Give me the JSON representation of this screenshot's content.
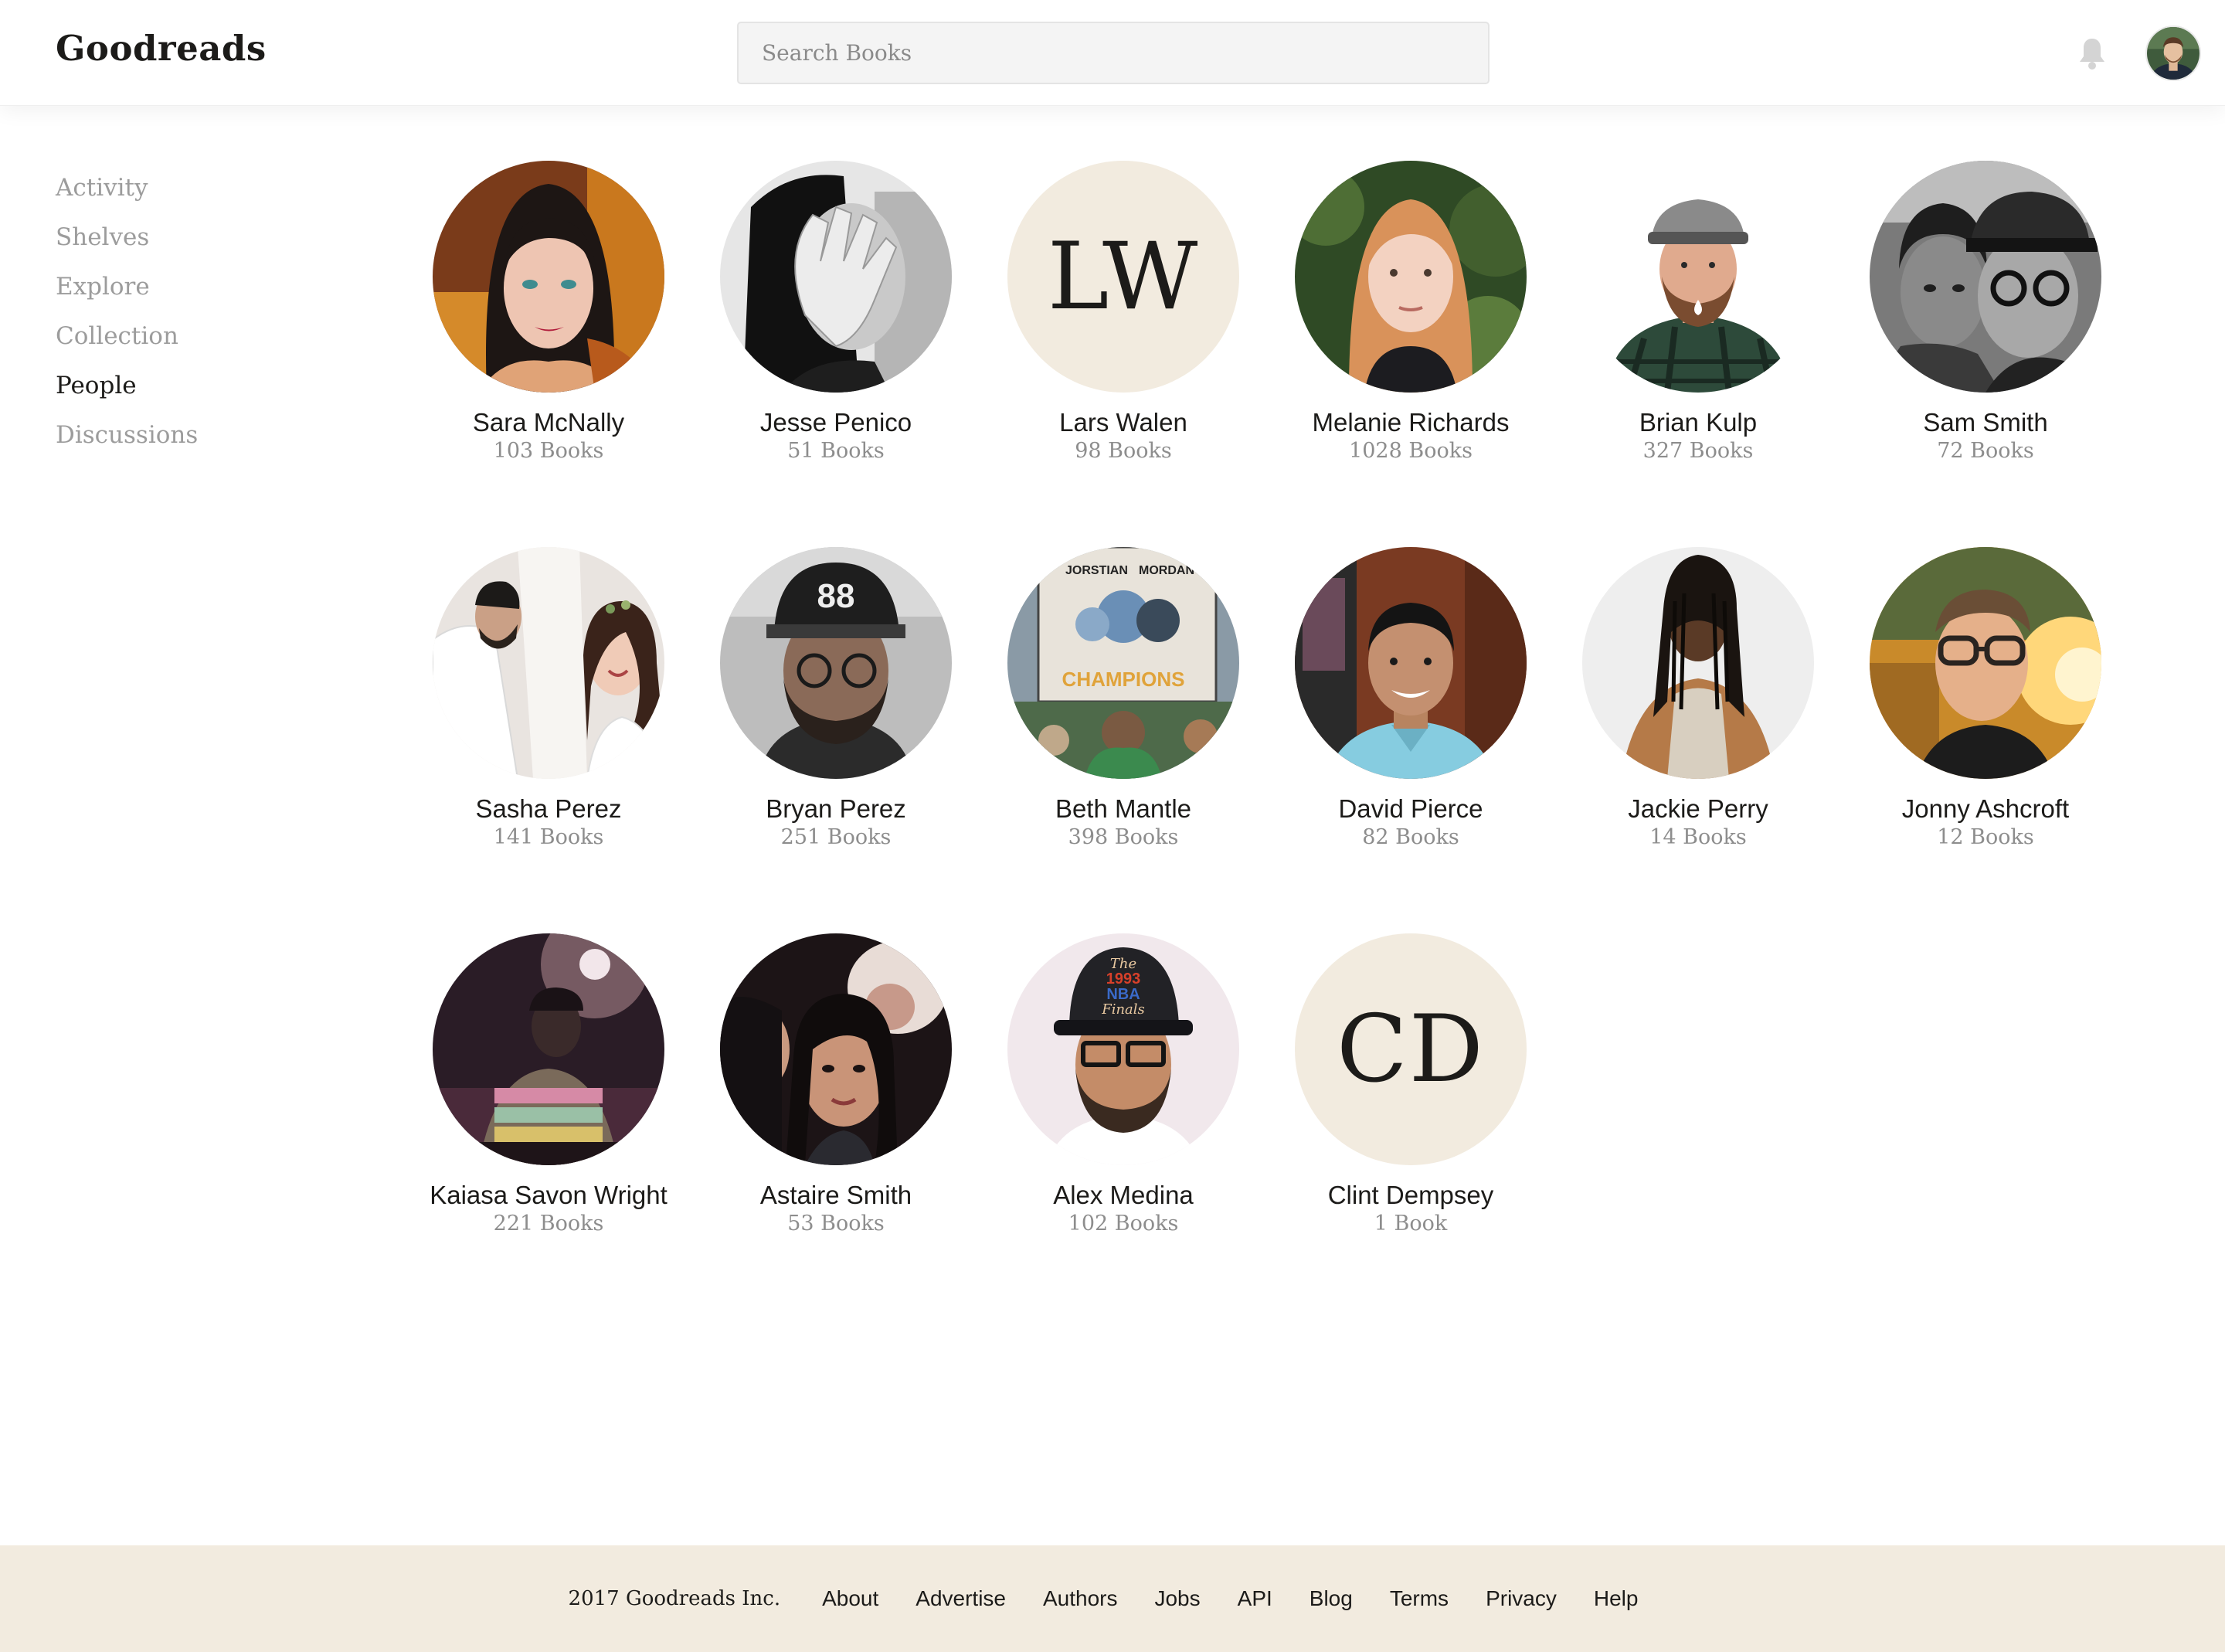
{
  "header": {
    "brand": "Goodreads",
    "search_placeholder": "Search Books"
  },
  "sidebar": {
    "items": [
      {
        "label": "Activity",
        "active": false
      },
      {
        "label": "Shelves",
        "active": false
      },
      {
        "label": "Explore",
        "active": false
      },
      {
        "label": "Collection",
        "active": false
      },
      {
        "label": "People",
        "active": true
      },
      {
        "label": "Discussions",
        "active": false
      }
    ]
  },
  "people": [
    {
      "name": "Sara McNally",
      "books": "103 Books"
    },
    {
      "name": "Jesse Penico",
      "books": "51 Books"
    },
    {
      "name": "Lars Walen",
      "books": "98 Books",
      "initials": "LW"
    },
    {
      "name": "Melanie Richards",
      "books": "1028 Books"
    },
    {
      "name": "Brian Kulp",
      "books": "327 Books"
    },
    {
      "name": "Sam Smith",
      "books": "72 Books"
    },
    {
      "name": "Sasha Perez",
      "books": "141 Books"
    },
    {
      "name": "Bryan Perez",
      "books": "251 Books"
    },
    {
      "name": "Beth Mantle",
      "books": "398 Books"
    },
    {
      "name": "David Pierce",
      "books": "82 Books"
    },
    {
      "name": "Jackie Perry",
      "books": "14 Books"
    },
    {
      "name": "Jonny Ashcroft",
      "books": "12 Books"
    },
    {
      "name": "Kaiasa Savon Wright",
      "books": "221 Books"
    },
    {
      "name": "Astaire Smith",
      "books": "53 Books"
    },
    {
      "name": "Alex Medina",
      "books": "102 Books"
    },
    {
      "name": "Clint Dempsey",
      "books": "1 Book",
      "initials": "CD"
    }
  ],
  "photo_sign": {
    "line1": "JORSTIAN",
    "line2": "MORDAN",
    "line3": "CHAMPIONS"
  },
  "cap_text": {
    "line1": "The",
    "line2": "1993",
    "line3": "NBA",
    "line4": "Finals"
  },
  "footer": {
    "copyright": "2017 Goodreads Inc.",
    "links": [
      "About",
      "Advertise",
      "Authors",
      "Jobs",
      "API",
      "Blog",
      "Terms",
      "Privacy",
      "Help"
    ]
  },
  "colors": {
    "accent_cream": "#f2ebdf",
    "text": "#1c1b19",
    "muted": "#9c9c9c"
  }
}
